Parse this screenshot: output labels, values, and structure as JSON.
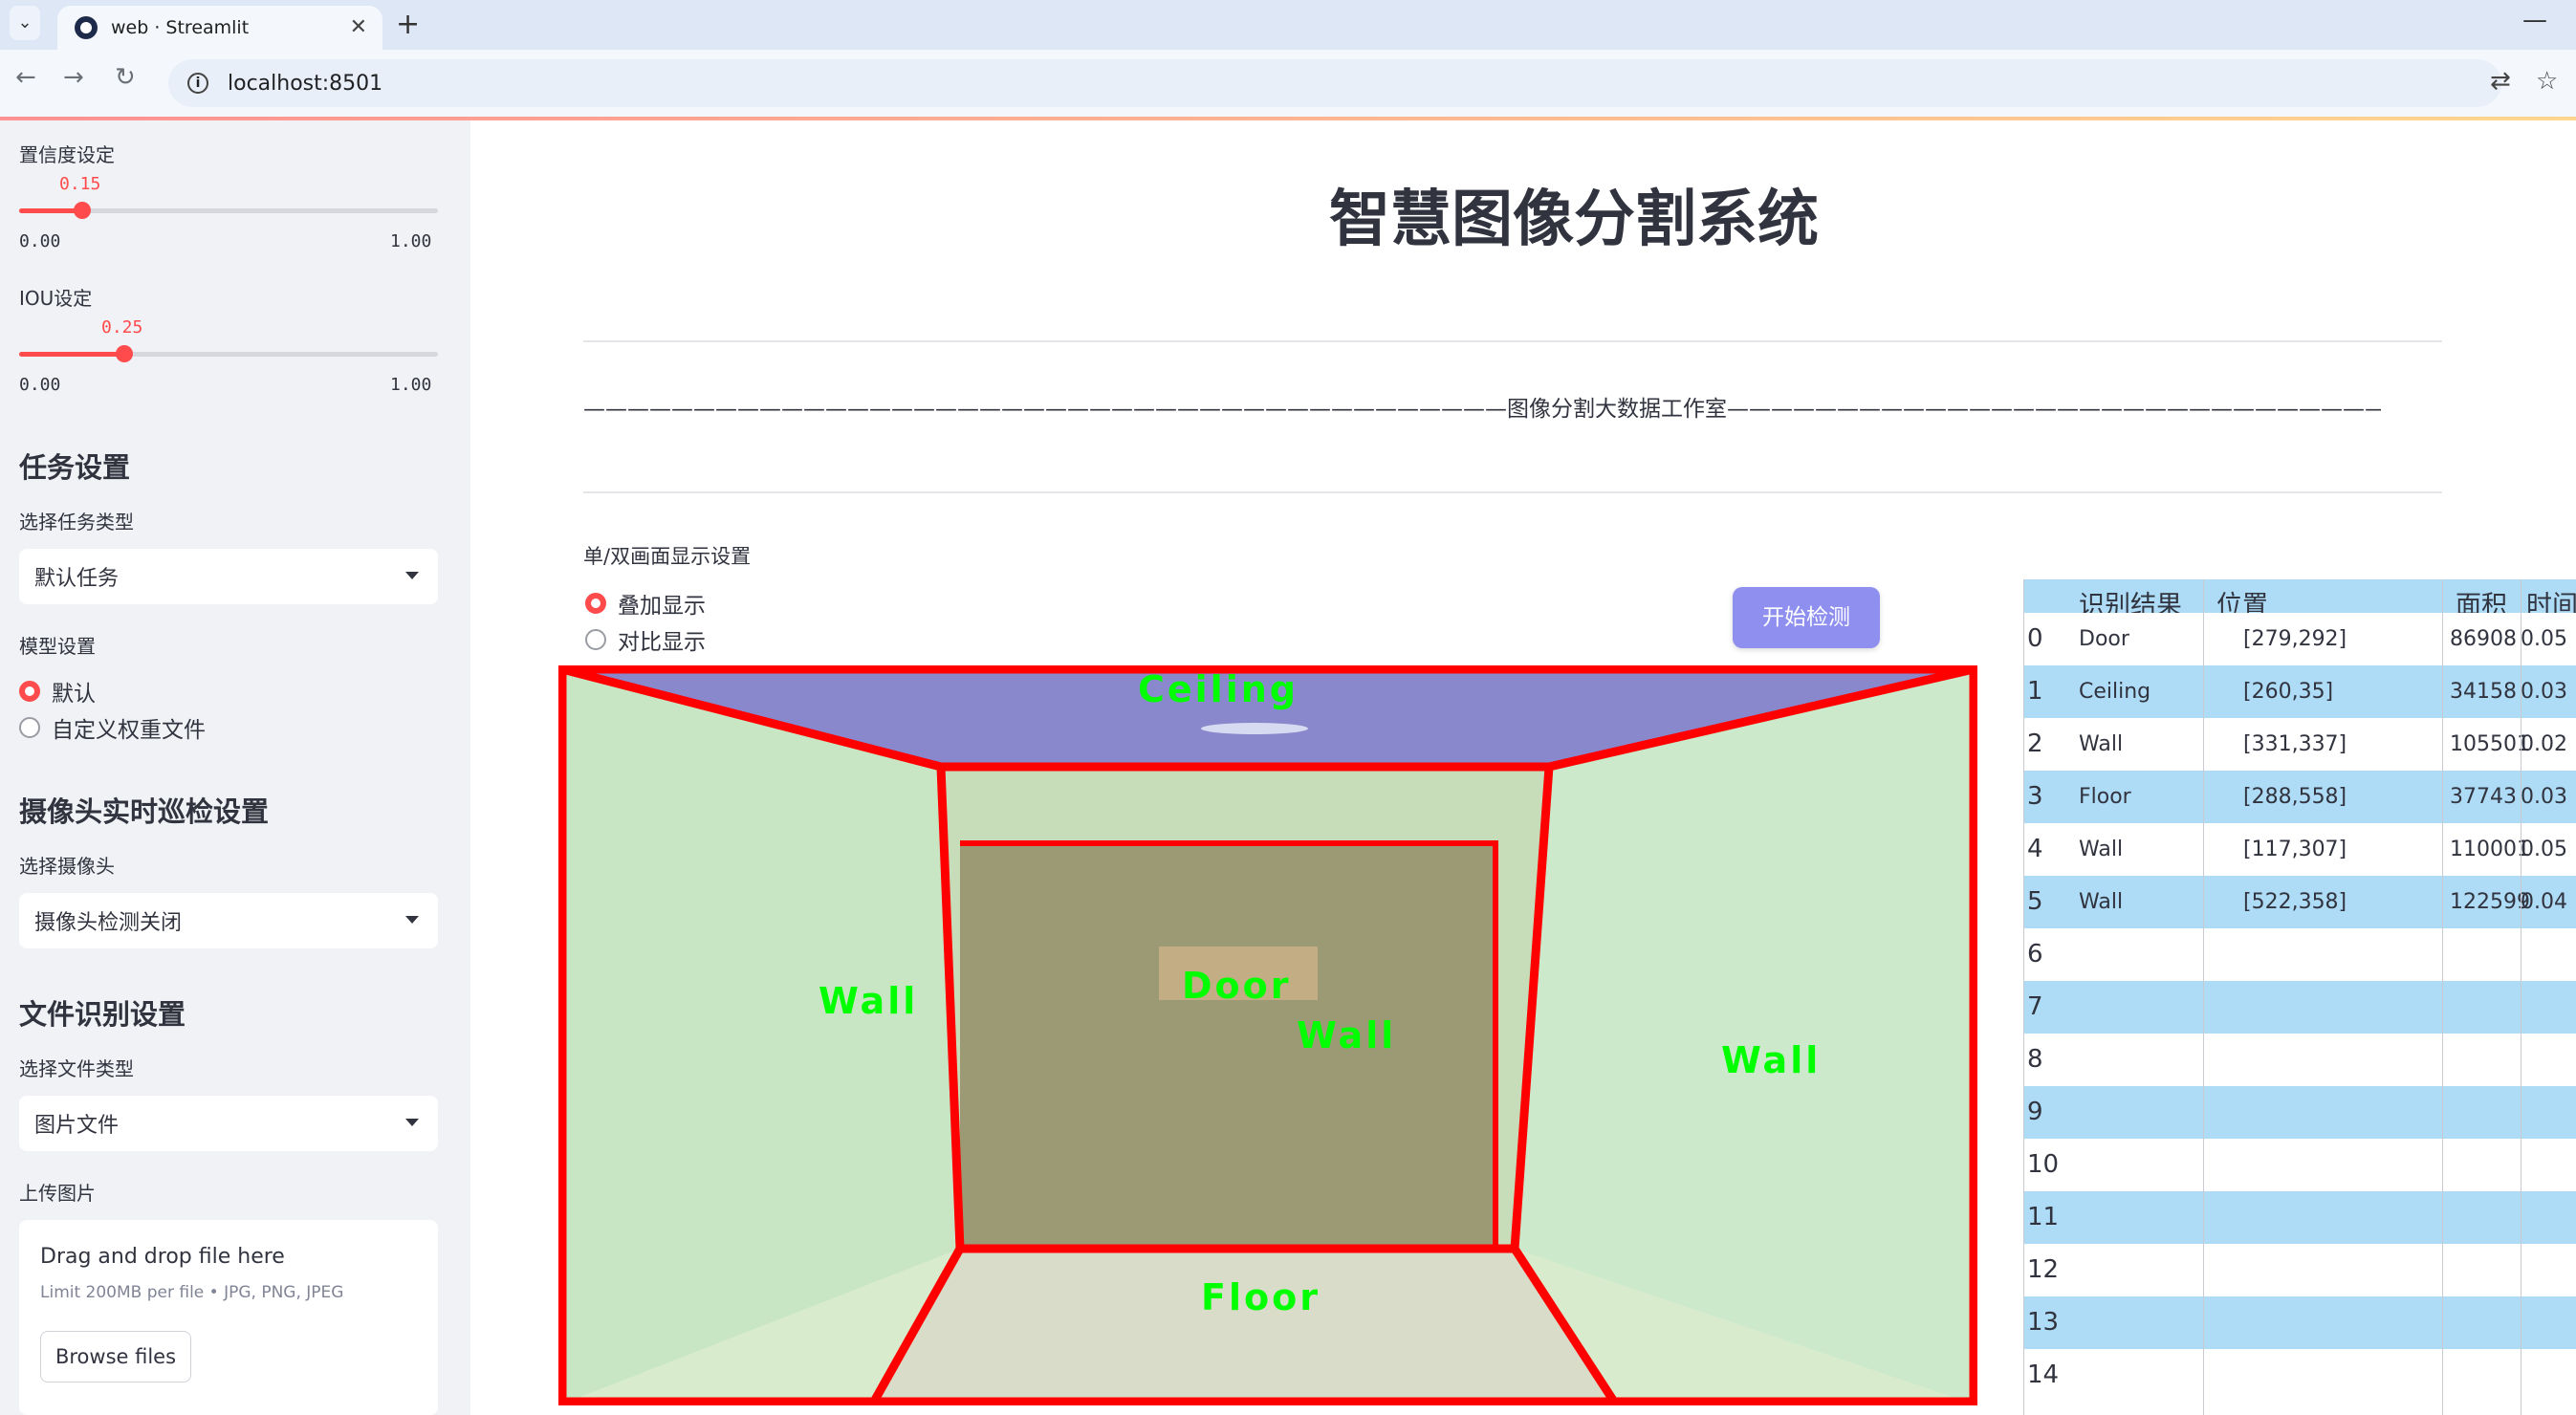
{
  "browser": {
    "tab_title": "web · Streamlit",
    "url": "localhost:8501"
  },
  "sidebar": {
    "confidence": {
      "label": "置信度设定",
      "value": "0.15",
      "value_num": 0.15,
      "min": "0.00",
      "max": "1.00"
    },
    "iou": {
      "label": "IOU设定",
      "value": "0.25",
      "value_num": 0.25,
      "min": "0.00",
      "max": "1.00"
    },
    "task_heading": "任务设置",
    "task_type_label": "选择任务类型",
    "task_type_value": "默认任务",
    "model_label": "模型设置",
    "model_options": [
      "默认",
      "自定义权重文件"
    ],
    "model_selected": "默认",
    "camera_heading": "摄像头实时巡检设置",
    "camera_label": "选择摄像头",
    "camera_value": "摄像头检测关闭",
    "file_heading": "文件识别设置",
    "file_type_label": "选择文件类型",
    "file_type_value": "图片文件",
    "upload_label": "上传图片",
    "upload_title": "Drag and drop file here",
    "upload_limit": "Limit 200MB per file • JPG, PNG, JPEG",
    "browse_label": "Browse files"
  },
  "main": {
    "title": "智慧图像分割系统",
    "subtitle_text": "图像分割大数据工作室",
    "display_mode_label": "单/双画面显示设置",
    "display_options": [
      "叠加显示",
      "对比显示"
    ],
    "display_selected": "叠加显示",
    "detect_button": "开始检测"
  },
  "image_labels": {
    "ceiling": "Ceiling",
    "wall_left": "Wall",
    "wall_center": "Wall",
    "wall_right": "Wall",
    "door": "Door",
    "floor": "Floor"
  },
  "results_table": {
    "columns": [
      "识别结果",
      "位置",
      "面积",
      "时间"
    ],
    "rows": [
      {
        "index": "0",
        "result": "Door",
        "position": "[279,292]",
        "area": "86908",
        "time": "0.05"
      },
      {
        "index": "1",
        "result": "Ceiling",
        "position": "[260,35]",
        "area": "34158",
        "time": "0.03"
      },
      {
        "index": "2",
        "result": "Wall",
        "position": "[331,337]",
        "area": "105501",
        "time": "0.02"
      },
      {
        "index": "3",
        "result": "Floor",
        "position": "[288,558]",
        "area": "37743",
        "time": "0.03"
      },
      {
        "index": "4",
        "result": "Wall",
        "position": "[117,307]",
        "area": "110001",
        "time": "0.05"
      },
      {
        "index": "5",
        "result": "Wall",
        "position": "[522,358]",
        "area": "122599",
        "time": "0.04"
      },
      {
        "index": "6"
      },
      {
        "index": "7"
      },
      {
        "index": "8"
      },
      {
        "index": "9"
      },
      {
        "index": "10"
      },
      {
        "index": "11"
      },
      {
        "index": "12"
      },
      {
        "index": "13"
      },
      {
        "index": "14"
      }
    ]
  },
  "colors": {
    "accent": "#ff4b4b",
    "sidebar_bg": "#f0f2f6",
    "table_stripe": "#aedcf7",
    "button": "#8e8fee",
    "mask_outline": "#ff0000",
    "label_text": "#00ff00"
  }
}
